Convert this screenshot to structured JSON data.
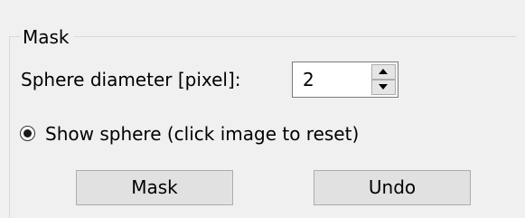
{
  "group": {
    "title": "Mask"
  },
  "sphere_diameter": {
    "label": "Sphere diameter [pixel]:",
    "value": "2"
  },
  "show_sphere": {
    "label": "Show sphere (click image to reset)",
    "checked": true
  },
  "buttons": {
    "mask_label": "Mask",
    "undo_label": "Undo"
  }
}
